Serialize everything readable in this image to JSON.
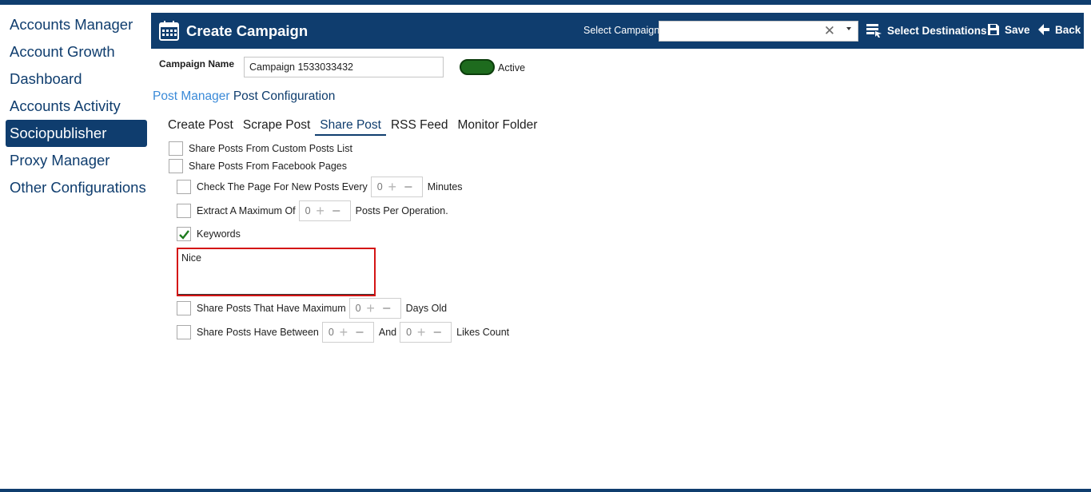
{
  "sidebar": {
    "items": [
      {
        "label": "Accounts Manager",
        "active": false
      },
      {
        "label": "Account Growth",
        "active": false
      },
      {
        "label": "Dashboard",
        "active": false
      },
      {
        "label": "Accounts Activity",
        "active": false
      },
      {
        "label": "Sociopublisher",
        "active": true
      },
      {
        "label": "Proxy Manager",
        "active": false
      },
      {
        "label": "Other Configurations",
        "active": false
      }
    ]
  },
  "header": {
    "title": "Create Campaign",
    "select_campaign_label": "Select Campaign",
    "select_campaign_value": "",
    "select_destinations_label": "Select Destinations",
    "save_label": "Save",
    "back_label": "Back",
    "icons": [
      "calendar-icon",
      "clear-x-icon",
      "dropdown-caret-icon",
      "destinations-icon",
      "save-disk-icon",
      "back-arrow-icon"
    ]
  },
  "campaign": {
    "name_label": "Campaign Name",
    "name_value": "Campaign 1533033432",
    "status_label": "Active",
    "active": true
  },
  "breadcrumb": {
    "link": "Post Manager",
    "current": "Post Configuration"
  },
  "tabs": [
    {
      "label": "Create Post",
      "active": false
    },
    {
      "label": "Scrape Post",
      "active": false
    },
    {
      "label": "Share Post",
      "active": true
    },
    {
      "label": "RSS Feed",
      "active": false
    },
    {
      "label": "Monitor Folder",
      "active": false
    }
  ],
  "options": {
    "custom_list": {
      "label": "Share Posts From Custom Posts List",
      "checked": false
    },
    "facebook_pages": {
      "label": "Share Posts From Facebook Pages",
      "checked": false
    },
    "check_page": {
      "label": "Check The Page For New Posts Every",
      "value": "0",
      "suffix": "Minutes",
      "checked": false
    },
    "extract_max": {
      "label": "Extract A Maximum Of",
      "value": "0",
      "suffix": "Posts Per Operation.",
      "checked": false
    },
    "keywords": {
      "label": "Keywords",
      "checked": true,
      "value": "Nice"
    },
    "max_days": {
      "label": "Share Posts That Have Maximum",
      "value": "0",
      "suffix": "Days Old",
      "checked": false
    },
    "likes_between": {
      "label": "Share Posts Have Between",
      "value_min": "0",
      "and_label": "And",
      "value_max": "0",
      "suffix": "Likes Count",
      "checked": false
    }
  }
}
